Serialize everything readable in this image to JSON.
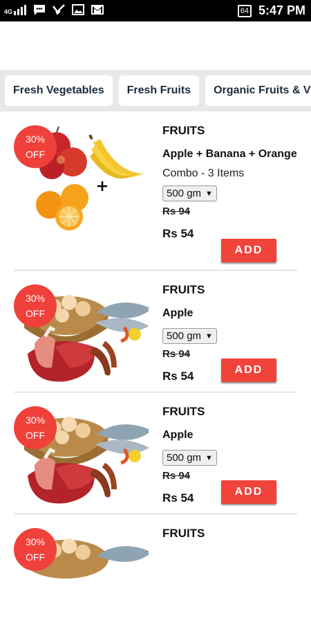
{
  "status": {
    "network": "4G",
    "battery": "64",
    "time": "5:47 PM"
  },
  "categories": [
    "Fresh Vegetables",
    "Fresh Fruits",
    "Organic Fruits & V"
  ],
  "products": [
    {
      "badge_percent": "30%",
      "badge_off": "OFF",
      "category": "FRUITS",
      "name": "Apple + Banana + Orange",
      "subtitle": "Combo - 3 Items",
      "weight": "500 gm",
      "old_price": "Rs 94",
      "price": "Rs 54",
      "add_label": "ADD",
      "image": "fruit-combo-image"
    },
    {
      "badge_percent": "30%",
      "badge_off": "OFF",
      "category": "FRUITS",
      "name": "Apple",
      "weight": "500 gm",
      "old_price": "Rs 94",
      "price": "Rs 54",
      "add_label": "ADD",
      "image": "meat-fish-eggs-image"
    },
    {
      "badge_percent": "30%",
      "badge_off": "OFF",
      "category": "FRUITS",
      "name": "Apple",
      "weight": "500 gm",
      "old_price": "Rs 94",
      "price": "Rs 54",
      "add_label": "ADD",
      "image": "meat-fish-eggs-image"
    },
    {
      "badge_percent": "30%",
      "badge_off": "OFF",
      "category": "FRUITS",
      "image": "meat-fish-eggs-image"
    }
  ],
  "colors": {
    "accent": "#f0443b",
    "badge": "#f0403a",
    "strip": "#e8e8e8"
  }
}
